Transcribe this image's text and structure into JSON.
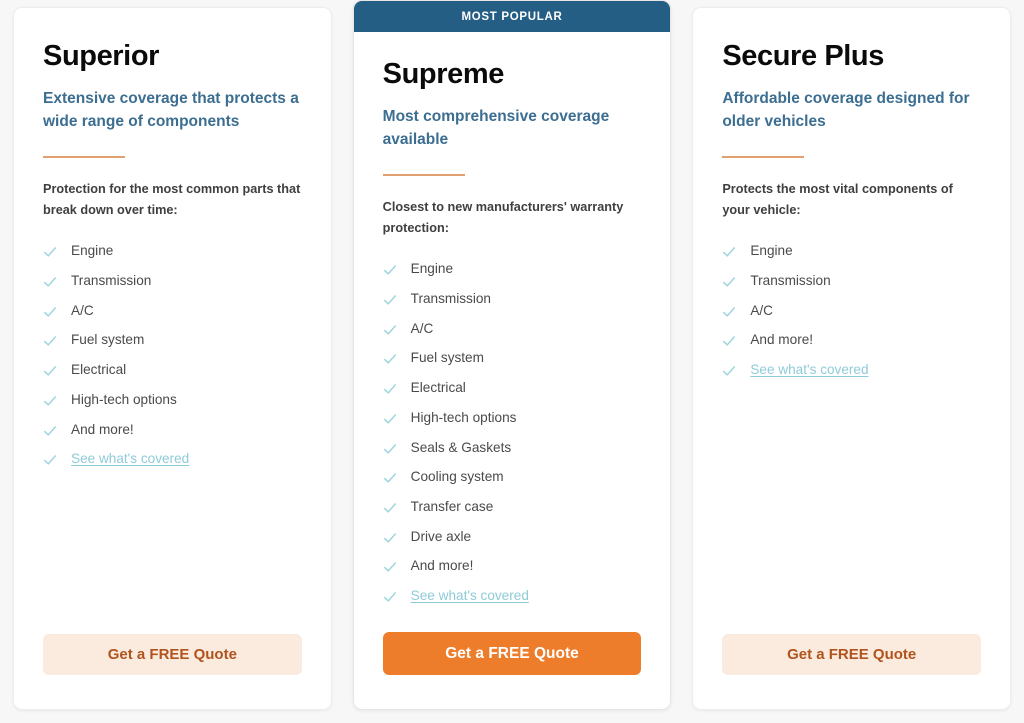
{
  "colors": {
    "page_background": "#f7f7f7",
    "card_background": "#ffffff",
    "banner": "#245e85",
    "subtitle": "#3c6e91",
    "divider": "#e0a070",
    "check": "#9ed5de",
    "link": "#8fcbd8",
    "cta_primary_bg": "#ee7d2b",
    "cta_primary_text": "#ffffff",
    "cta_secondary_bg": "#fbeade",
    "cta_secondary_text": "#b0541e"
  },
  "plans": [
    {
      "id": "superior",
      "badge": null,
      "title": "Superior",
      "subtitle": "Extensive coverage that protects a wide range of components",
      "intro": "Protection for the most common parts that break down over time:",
      "features": [
        {
          "label": "Engine",
          "link": false
        },
        {
          "label": "Transmission",
          "link": false
        },
        {
          "label": "A/C",
          "link": false
        },
        {
          "label": "Fuel system",
          "link": false
        },
        {
          "label": "Electrical",
          "link": false
        },
        {
          "label": "High-tech options",
          "link": false
        },
        {
          "label": "And more!",
          "link": false
        },
        {
          "label": "See what's covered",
          "link": true
        }
      ],
      "cta_label": "Get a FREE Quote",
      "cta_style": "secondary"
    },
    {
      "id": "supreme",
      "badge": "MOST POPULAR",
      "title": "Supreme",
      "subtitle": "Most comprehensive coverage available",
      "intro": "Closest to new manufacturers' warranty protection:",
      "features": [
        {
          "label": "Engine",
          "link": false
        },
        {
          "label": "Transmission",
          "link": false
        },
        {
          "label": "A/C",
          "link": false
        },
        {
          "label": "Fuel system",
          "link": false
        },
        {
          "label": "Electrical",
          "link": false
        },
        {
          "label": "High-tech options",
          "link": false
        },
        {
          "label": "Seals & Gaskets",
          "link": false
        },
        {
          "label": "Cooling system",
          "link": false
        },
        {
          "label": "Transfer case",
          "link": false
        },
        {
          "label": "Drive axle",
          "link": false
        },
        {
          "label": "And more!",
          "link": false
        },
        {
          "label": "See what's covered",
          "link": true
        }
      ],
      "cta_label": "Get a FREE Quote",
      "cta_style": "primary"
    },
    {
      "id": "secure-plus",
      "badge": null,
      "title": "Secure Plus",
      "subtitle": "Affordable coverage designed for older vehicles",
      "intro": "Protects the most vital components of your vehicle:",
      "features": [
        {
          "label": "Engine",
          "link": false
        },
        {
          "label": "Transmission",
          "link": false
        },
        {
          "label": "A/C",
          "link": false
        },
        {
          "label": "And more!",
          "link": false
        },
        {
          "label": "See what's covered",
          "link": true
        }
      ],
      "cta_label": "Get a FREE Quote",
      "cta_style": "secondary"
    }
  ],
  "icons": {
    "check": "check-icon"
  }
}
